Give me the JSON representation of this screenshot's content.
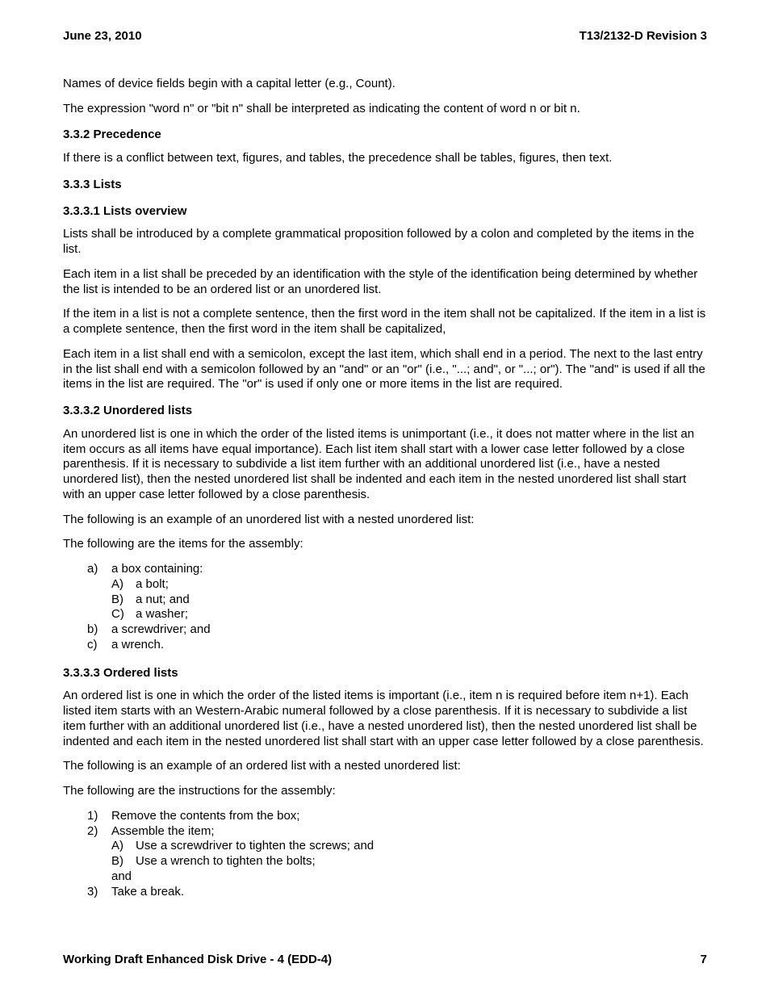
{
  "header": {
    "date": "June 23, 2010",
    "docid": "T13/2132-D Revision 3"
  },
  "paragraphs": {
    "p1": "Names of device fields begin with a capital letter (e.g., Count).",
    "p2": "The expression \"word n\" or \"bit n\" shall be interpreted as indicating the content of word n or bit n.",
    "h332": "3.3.2 Precedence",
    "p3": "If there is a conflict between text, figures, and tables, the precedence shall be tables, figures, then text.",
    "h333": "3.3.3 Lists",
    "h3331": "3.3.3.1 Lists overview",
    "p4": "Lists shall be introduced by a complete grammatical proposition followed by a colon and completed by the items in the list.",
    "p5": "Each item in a list shall be preceded by an identification with the style of the identification being determined by whether the list is intended to be an ordered list or an unordered list.",
    "p6": "If the item in a list is not a complete sentence, then the first word in the item shall not be capitalized.  If the item in a list is a complete sentence, then the first word in the item shall be capitalized,",
    "p7": "Each item in a list shall end with a semicolon, except the last item, which shall end in a period.  The next to the last entry in the list shall end with a semicolon followed by an \"and\" or an \"or\" (i.e., \"...; and\", or \"...; or\").  The \"and\" is used if all the items in the list are required.  The \"or\" is used if only one or more items in the list are required.",
    "h3332": "3.3.3.2 Unordered lists",
    "p8": "An unordered list is one in which the order of the listed items is unimportant (i.e., it does not matter where in the list an item occurs as all items have equal importance).  Each list item shall start with a lower case letter followed by a close parenthesis.  If it is necessary to subdivide a list item further with an additional unordered list (i.e., have a nested unordered list), then the nested unordered list shall be indented and each item in the nested unordered list shall start with an upper case letter followed by a close parenthesis.",
    "p9": "The following is an example of an unordered list with a nested unordered list:",
    "p10": "The following are the items for the assembly:",
    "h3333": "3.3.3.3 Ordered lists",
    "p11": "An ordered list is one in which the order of the listed items is important (i.e., item n is required before item n+1).  Each listed item starts with an Western-Arabic numeral followed by a close parenthesis.  If it is necessary to subdivide a list item further with an additional unordered list (i.e., have a nested unordered list), then the nested unordered list shall be indented and each item in the nested unordered list shall start with an upper case letter followed by a close parenthesis.",
    "p12": "The following is an example of an ordered list with a nested unordered list:",
    "p13": "The following are the instructions for the assembly:"
  },
  "listA": {
    "a_marker": "a)",
    "a_text": "a box containing:",
    "A_marker": "A)",
    "A_text": "a bolt;",
    "B_marker": "B)",
    "B_text": "a nut; and",
    "C_marker": "C)",
    "C_text": "a washer;",
    "b_marker": "b)",
    "b_text": "a screwdriver; and",
    "c_marker": "c)",
    "c_text": "a wrench."
  },
  "listB": {
    "m1": "1)",
    "t1": "Remove the contents from the box;",
    "m2": "2)",
    "t2": "Assemble the item;",
    "mA": "A)",
    "tA": "Use a screwdriver to tighten the screws; and",
    "mB": "B)",
    "tB": "Use a wrench to tighten the bolts;",
    "and": "and",
    "m3": "3)",
    "t3": "Take a break."
  },
  "footer": {
    "title": "Working Draft Enhanced Disk Drive - 4  (EDD-4)",
    "page": "7"
  }
}
